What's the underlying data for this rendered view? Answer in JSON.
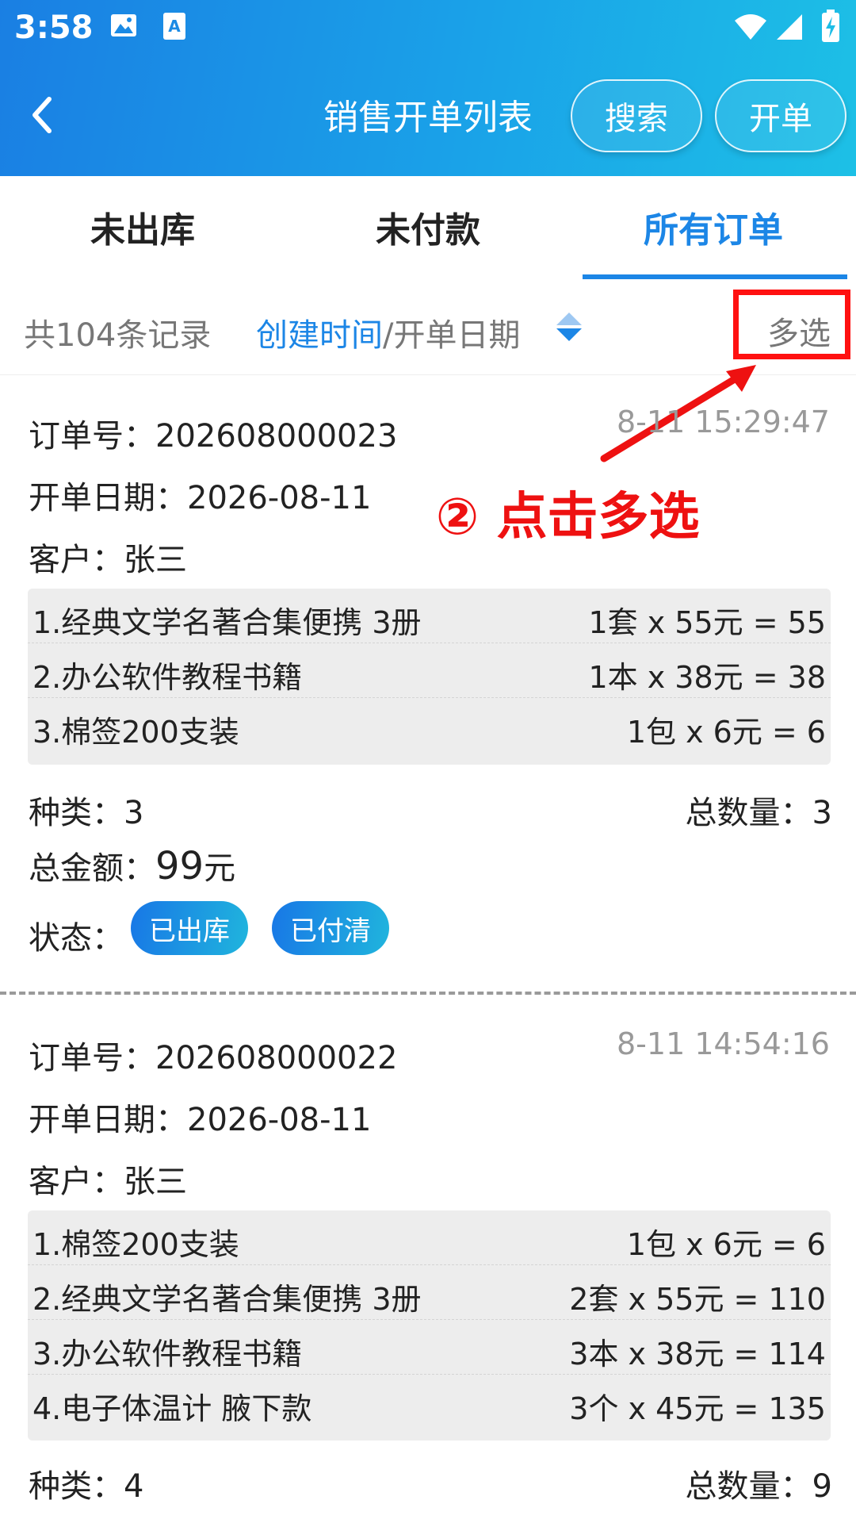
{
  "status_bar": {
    "time": "3:58"
  },
  "header": {
    "title": "销售开单列表",
    "search_label": "搜索",
    "create_label": "开单"
  },
  "tabs": [
    {
      "label": "未出库",
      "active": false
    },
    {
      "label": "未付款",
      "active": false
    },
    {
      "label": "所有订单",
      "active": true
    }
  ],
  "filter": {
    "count_text": "共104条记录",
    "sort_active": "创建时间",
    "sort_rest": "/开单日期",
    "multi_select_label": "多选"
  },
  "annotation": {
    "text": "② 点击多选",
    "color": "#ee1111"
  },
  "orders": [
    {
      "order_no_text": "订单号：202608000023",
      "date_text": "开单日期：2026-08-11",
      "customer_text": "客户：张三",
      "time": "8-11 15:29:47",
      "items": [
        {
          "name": "1.经典文学名著合集便携 3册",
          "calc": "1套 x 55元 = 55"
        },
        {
          "name": "2.办公软件教程书籍",
          "calc": "1本 x 38元 = 38"
        },
        {
          "name": "3.棉签200支装",
          "calc": "1包 x 6元 = 6"
        }
      ],
      "kinds_text": "种类：3",
      "total_qty_text": "总数量：3",
      "amount_label": "总金额：",
      "amount_value": "99",
      "amount_unit": "元",
      "status_label": "状态：",
      "badges": [
        "已出库",
        "已付清"
      ]
    },
    {
      "order_no_text": "订单号：202608000022",
      "date_text": "开单日期：2026-08-11",
      "customer_text": "客户：张三",
      "time": "8-11 14:54:16",
      "items": [
        {
          "name": "1.棉签200支装",
          "calc": "1包 x 6元 = 6"
        },
        {
          "name": "2.经典文学名著合集便携 3册",
          "calc": "2套 x 55元 = 110"
        },
        {
          "name": "3.办公软件教程书籍",
          "calc": "3本 x 38元 = 114"
        },
        {
          "name": "4.电子体温计 腋下款",
          "calc": "3个 x 45元 = 135"
        }
      ],
      "kinds_text": "种类：4",
      "total_qty_text": "总数量：9"
    }
  ],
  "colors": {
    "accent": "#1c86e6",
    "header_start": "#1a7fe3",
    "header_end": "#1dc0e6"
  }
}
